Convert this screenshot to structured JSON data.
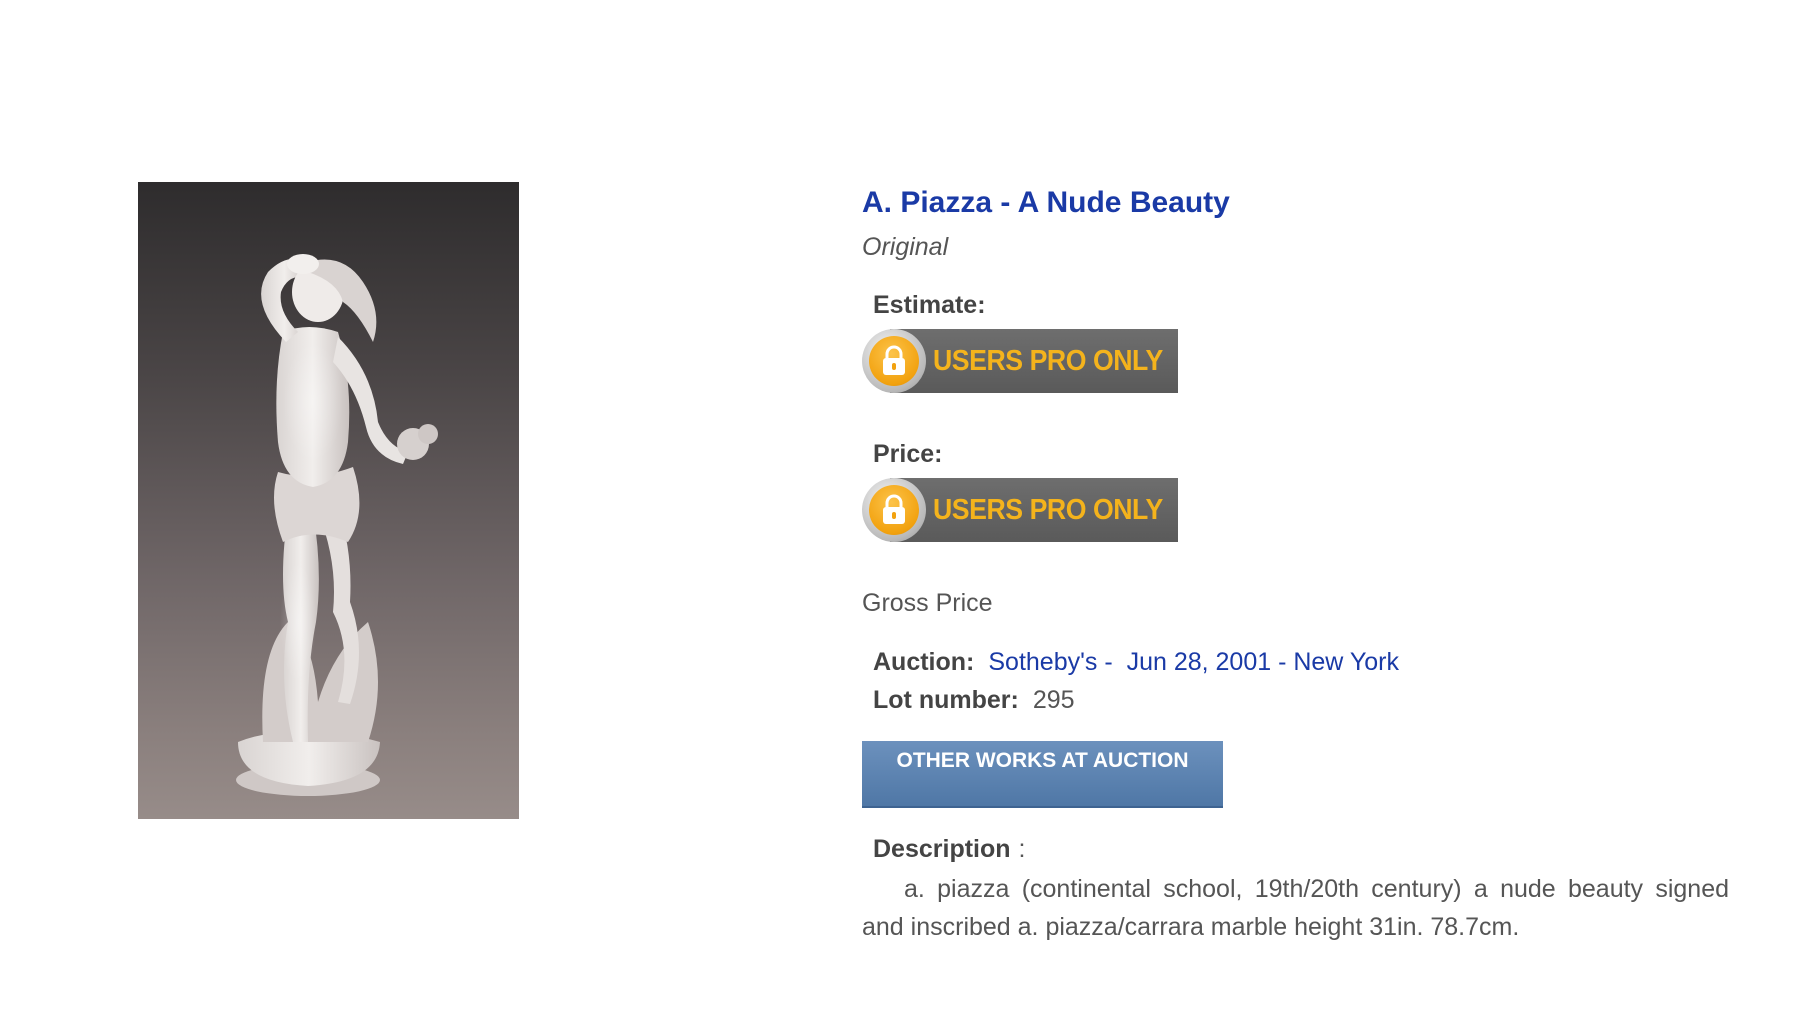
{
  "artwork": {
    "alt": "A. Piazza - A Nude Beauty",
    "background_color": "#5e5656"
  },
  "lot": {
    "title": "A. Piazza - A Nude Beauty",
    "type": "Original"
  },
  "estimate": {
    "label": "Estimate:",
    "badge_text": "USERS PRO ONLY",
    "badge_icon": "lock-icon"
  },
  "price": {
    "label": "Price:",
    "badge_text": "USERS PRO ONLY",
    "badge_icon": "lock-icon"
  },
  "gross_price_label": "Gross Price",
  "auction": {
    "label": "Auction:",
    "house": "Sotheby's -",
    "date_location": "Jun 28, 2001 - New York"
  },
  "lot_number": {
    "label": "Lot number:",
    "value": "295"
  },
  "other_works_button": "OTHER WORKS AT AUCTION",
  "description": {
    "label": "Description",
    "separator": ":",
    "text": "a. piazza (continental school, 19th/20th century) a nude beauty signed and inscribed a. piazza/carrara marble height 31in. 78.7cm."
  },
  "colors": {
    "title_link": "#1a3aa6",
    "text": "#444444",
    "badge_text": "#f4b31c",
    "badge_background": "#5e5e5e",
    "button_background": "#5a80ae"
  }
}
